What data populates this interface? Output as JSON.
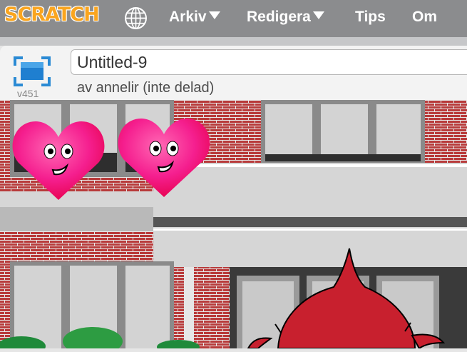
{
  "menubar": {
    "logo_text": "SCRATCH",
    "menu_items": [
      {
        "label": "Arkiv",
        "dropdown": true
      },
      {
        "label": "Redigera",
        "dropdown": true
      },
      {
        "label": "Tips",
        "dropdown": false
      },
      {
        "label": "Om",
        "dropdown": false
      }
    ],
    "icons": [
      "globe-icon",
      "caret-down-icon"
    ],
    "colors": {
      "bar": "#8b8c8e",
      "logo": "#faa51f"
    }
  },
  "project": {
    "title": "Untitled-9",
    "version": "v451",
    "byline": "av annelir (inte delad)",
    "icons": [
      "fullscreen-icon"
    ]
  },
  "stage": {
    "sprites": [
      "heart-sprite",
      "heart-sprite",
      "red-creature-sprite"
    ],
    "backdrop": "school-building"
  }
}
